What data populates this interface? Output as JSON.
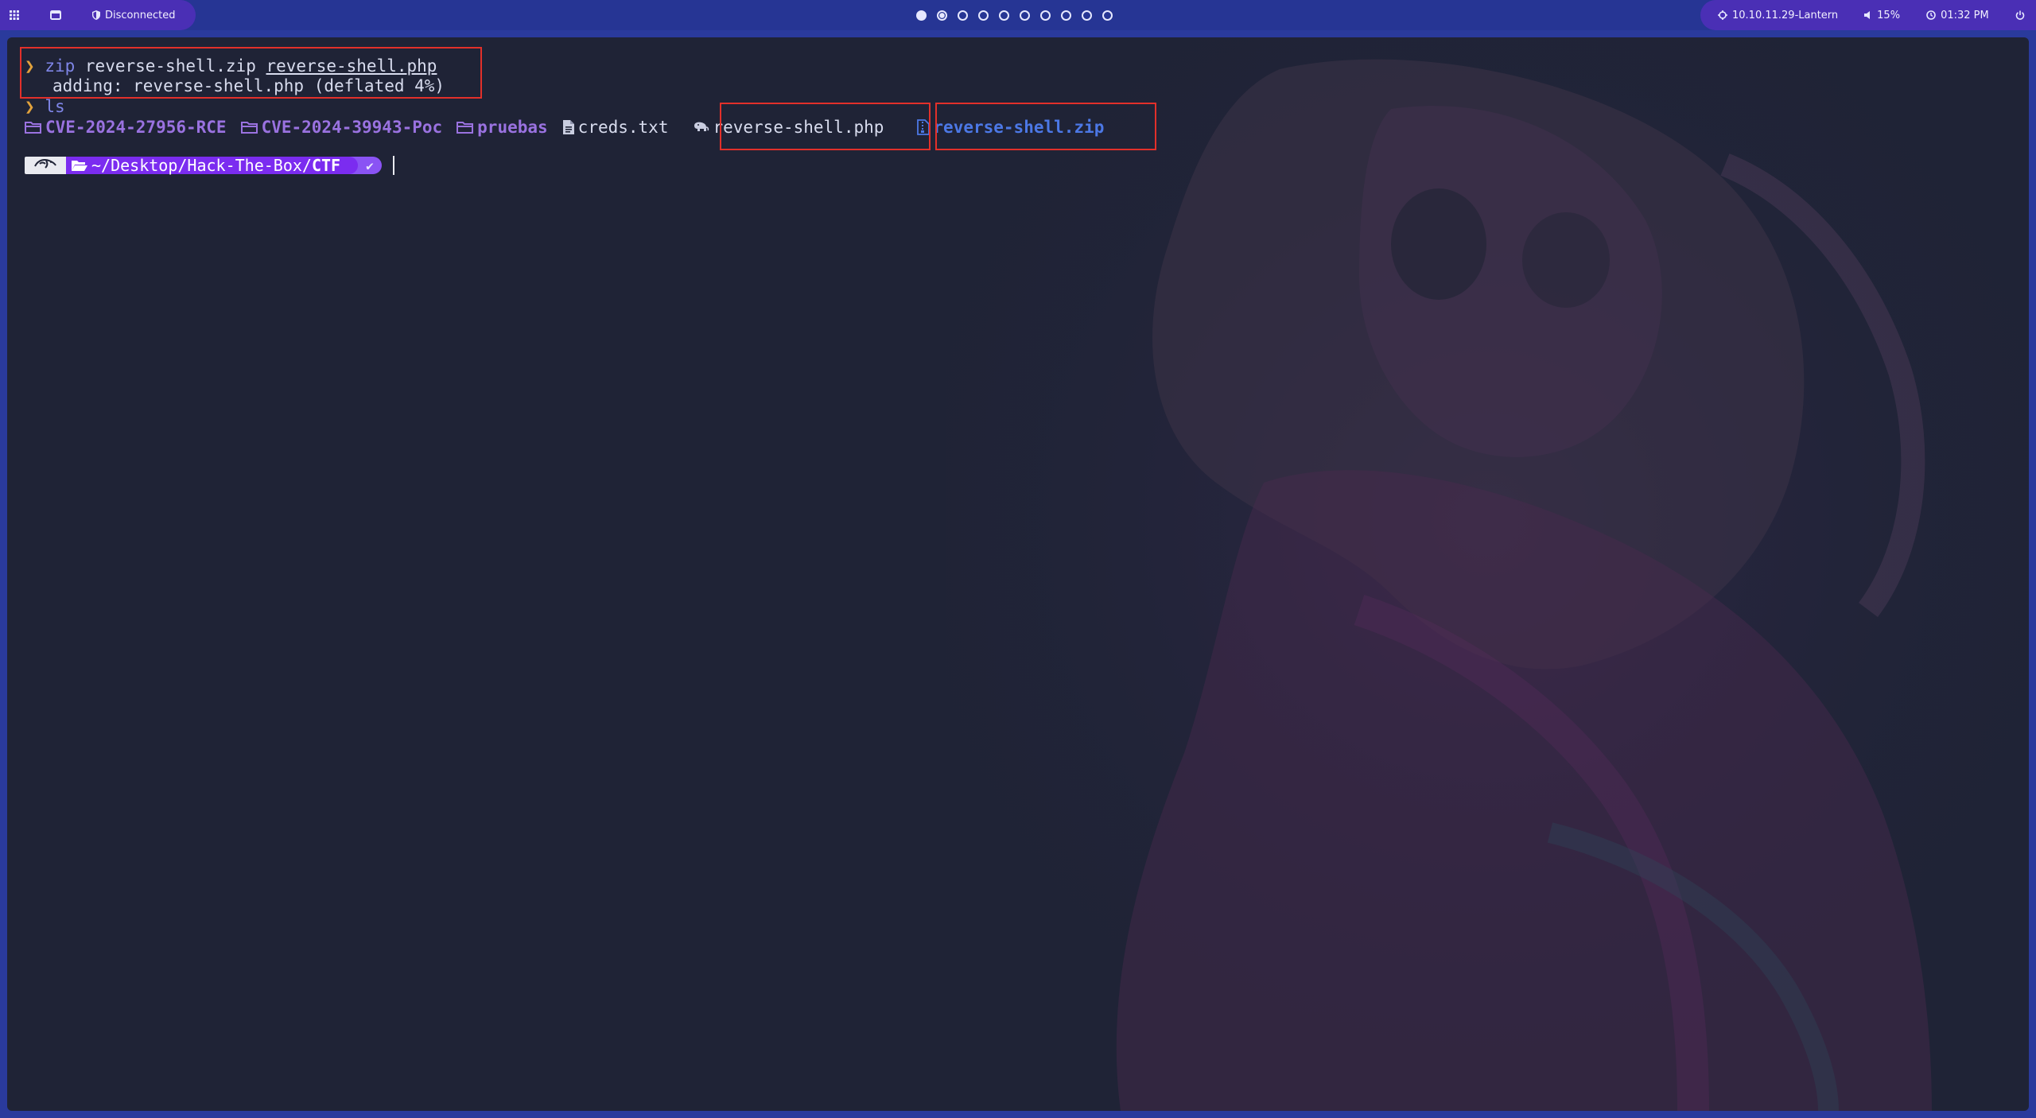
{
  "topbar": {
    "left": {
      "menu_icon": "grid-icon",
      "window_icon": "window-icon",
      "vpn_icon": "shield-icon",
      "vpn_status": "Disconnected"
    },
    "workspaces": {
      "count": 10,
      "active_index": 0,
      "occupied_index": 1
    },
    "right": {
      "target_icon": "crosshair-icon",
      "target": "10.10.11.29-Lantern",
      "volume_icon": "speaker-icon",
      "volume": "15%",
      "clock_icon": "clock-icon",
      "time": "01:32 PM",
      "power_icon": "power-icon"
    }
  },
  "terminal": {
    "line1": {
      "prompt": "❯",
      "command": "zip",
      "arg1": "reverse-shell.zip",
      "arg2": "reverse-shell.php"
    },
    "line2": {
      "output": "adding: reverse-shell.php (deflated 4%)"
    },
    "line3": {
      "prompt": "❯",
      "command": "ls"
    },
    "ls_items": [
      {
        "name": "CVE-2024-27956-RCE",
        "type": "dir",
        "icon": "folder-icon"
      },
      {
        "name": "CVE-2024-39943-Poc",
        "type": "dir",
        "icon": "folder-icon"
      },
      {
        "name": "pruebas",
        "type": "dir",
        "icon": "folder-icon"
      },
      {
        "name": "creds.txt",
        "type": "file",
        "icon": "text-file-icon"
      },
      {
        "name": "reverse-shell.php",
        "type": "php",
        "icon": "php-elephant-icon"
      },
      {
        "name": "reverse-shell.zip",
        "type": "zip",
        "icon": "zip-file-icon"
      }
    ],
    "prompt_line": {
      "os_icon": "kali-dragon-icon",
      "folder_icon": "folder-open-icon",
      "path_prefix": "~/Desktop/Hack-The-Box/",
      "path_current": "CTF",
      "status": "✔"
    }
  },
  "colors": {
    "terminal_bg": "#1f2336",
    "bar_bg": "#263594",
    "pill_bg": "#4a2fb5",
    "highlight_box": "#e2302a",
    "dir": "#9a72e0",
    "zip": "#4c78e6",
    "prompt": "#e2a23c",
    "path_segment": "#7b2cf0"
  }
}
